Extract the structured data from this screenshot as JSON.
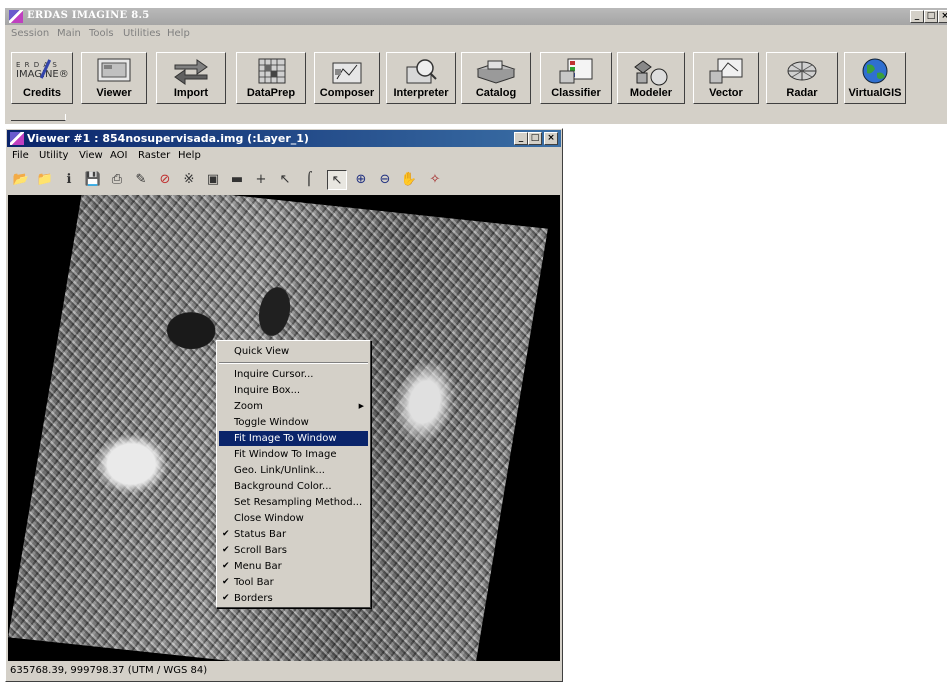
{
  "app": {
    "title": "ERDAS IMAGINE 8.5",
    "menus": [
      "Session",
      "Main",
      "Tools",
      "Utilities",
      "Help"
    ],
    "toolbar": [
      {
        "label": "Credits",
        "icon": "imagine-logo-icon"
      },
      {
        "label": "Viewer",
        "icon": "viewer-monitor-icon"
      },
      {
        "label": "Import",
        "icon": "import-arrows-icon"
      },
      {
        "label": "DataPrep",
        "icon": "dataprep-grid-icon"
      },
      {
        "label": "Composer",
        "icon": "composer-map-icon"
      },
      {
        "label": "Interpreter",
        "icon": "interpreter-magnifier-icon"
      },
      {
        "label": "Catalog",
        "icon": "catalog-tray-icon"
      },
      {
        "label": "Classifier",
        "icon": "classifier-legend-icon"
      },
      {
        "label": "Modeler",
        "icon": "modeler-shapes-icon"
      },
      {
        "label": "Vector",
        "icon": "vector-lines-icon"
      },
      {
        "label": "Radar",
        "icon": "radar-icon"
      },
      {
        "label": "VirtualGIS",
        "icon": "globe-icon"
      }
    ],
    "credits_logo": {
      "line1": "E R D A S",
      "line2": "IMAGINE®"
    }
  },
  "viewer": {
    "title": "Viewer #1 : 854nosupervisada.img (:Layer_1)",
    "menus": [
      "File",
      "Utility",
      "View",
      "AOI",
      "Raster",
      "Help"
    ],
    "status": "635768.39, 999798.37  (UTM / WGS 84)"
  },
  "context_menu": {
    "quick_view": "Quick View",
    "items": [
      {
        "label": "Inquire Cursor...",
        "checked": false,
        "submenu": false
      },
      {
        "label": "Inquire Box...",
        "checked": false,
        "submenu": false
      },
      {
        "label": "Zoom",
        "checked": false,
        "submenu": true
      },
      {
        "label": "Toggle Window",
        "checked": false,
        "submenu": false
      },
      {
        "label": "Fit Image To Window",
        "checked": false,
        "submenu": false,
        "highlighted": true
      },
      {
        "label": "Fit Window To Image",
        "checked": false,
        "submenu": false
      },
      {
        "label": "Geo. Link/Unlink...",
        "checked": false,
        "submenu": false
      },
      {
        "label": "Background Color...",
        "checked": false,
        "submenu": false
      },
      {
        "label": "Set Resampling Method...",
        "checked": false,
        "submenu": false
      },
      {
        "label": "Close Window",
        "checked": false,
        "submenu": false
      },
      {
        "label": "Status Bar",
        "checked": true,
        "submenu": false
      },
      {
        "label": "Scroll Bars",
        "checked": true,
        "submenu": false
      },
      {
        "label": "Menu Bar",
        "checked": true,
        "submenu": false
      },
      {
        "label": "Tool Bar",
        "checked": true,
        "submenu": false
      },
      {
        "label": "Borders",
        "checked": true,
        "submenu": false
      }
    ],
    "highlight_color": "#0a246a"
  },
  "window_buttons": {
    "minimize": "_",
    "maximize": "□",
    "close": "×"
  }
}
